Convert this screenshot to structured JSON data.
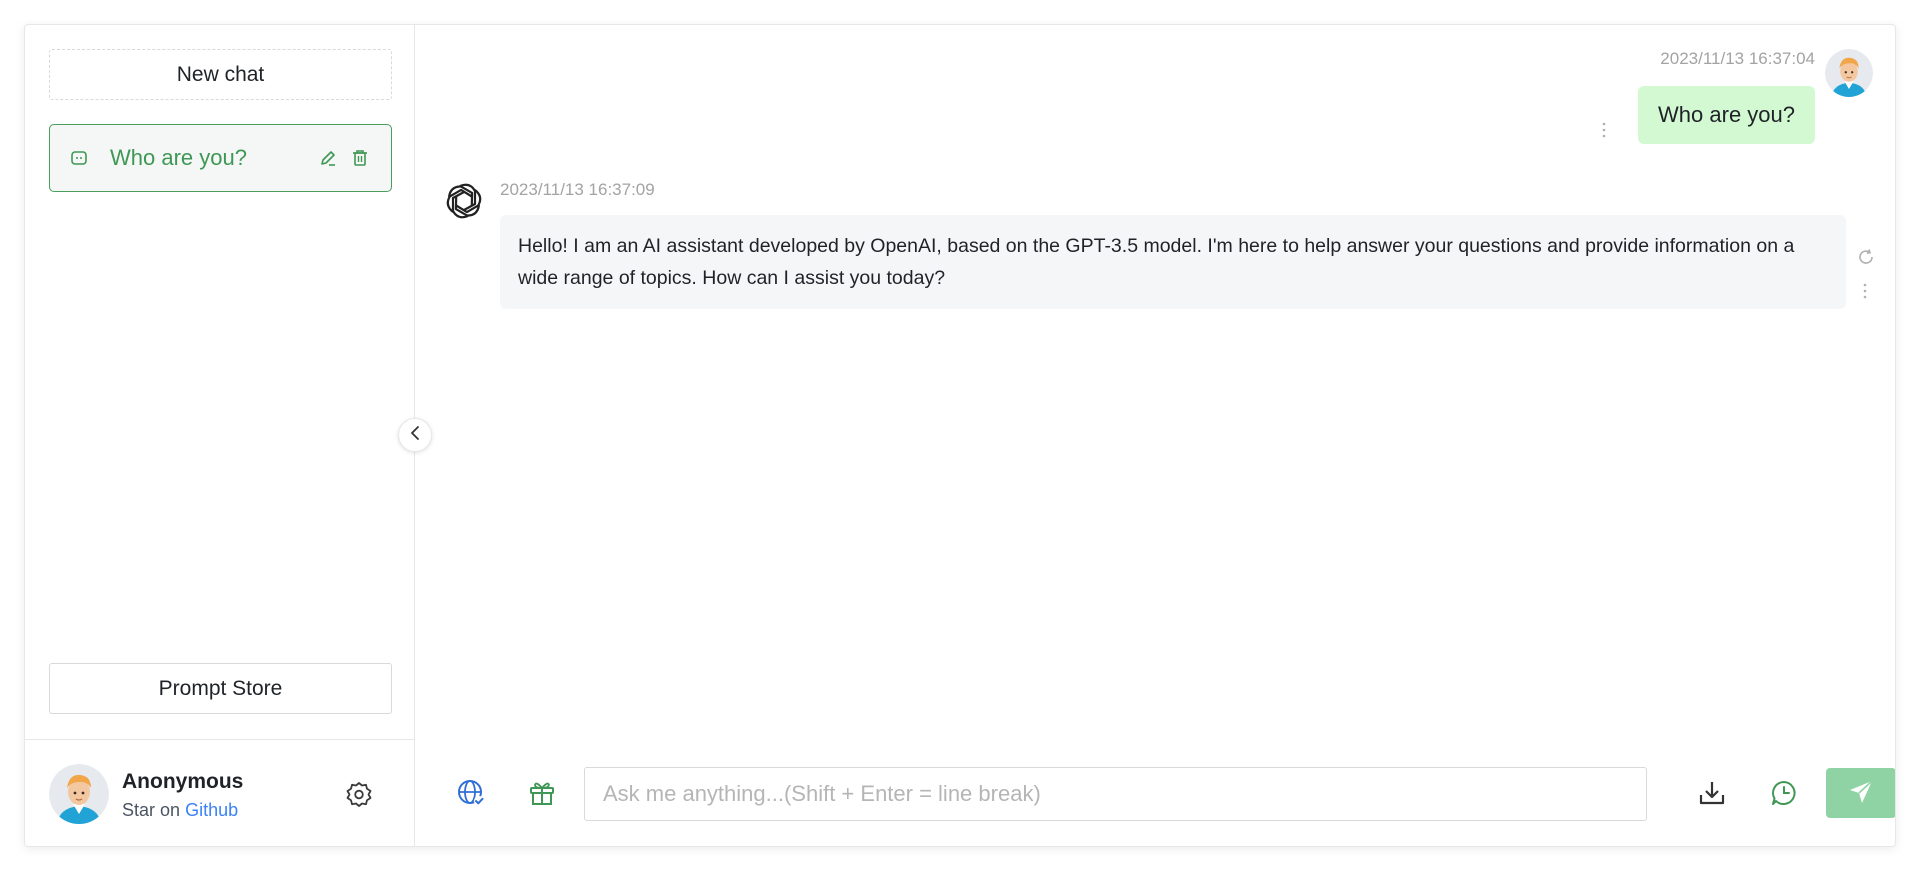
{
  "sidebar": {
    "new_chat_label": "New chat",
    "conversations": [
      {
        "title": "Who are you?",
        "active": true
      }
    ],
    "prompt_store_label": "Prompt Store",
    "user": {
      "name": "Anonymous",
      "star_prefix": "Star on",
      "star_link": "Github"
    }
  },
  "chat": {
    "messages": [
      {
        "role": "user",
        "time": "2023/11/13 16:37:04",
        "text": "Who are you?"
      },
      {
        "role": "assistant",
        "time": "2023/11/13 16:37:09",
        "text": "Hello! I am an AI assistant developed by OpenAI, based on the GPT-3.5 model. I'm here to help answer your questions and provide information on a wide range of topics. How can I assist you today?"
      }
    ]
  },
  "input": {
    "placeholder": "Ask me anything...(Shift + Enter = line break)",
    "value": ""
  },
  "colors": {
    "accent_green": "#3f9755",
    "user_bubble": "#d2f9d1",
    "bot_bubble": "#f4f6f8",
    "send_button": "#8fd3a4",
    "link_blue": "#3b82f6"
  },
  "icons": {
    "conversation": "chat-bubble-icon",
    "edit": "pencil-icon",
    "delete": "trash-icon",
    "settings": "gear-icon",
    "collapse": "chevron-left-icon",
    "bot": "openai-logo-icon",
    "regenerate": "refresh-icon",
    "more": "more-vertical-icon",
    "web": "globe-check-icon",
    "prompt": "gift-icon",
    "export": "download-icon",
    "history": "clock-chat-icon",
    "send": "send-icon"
  }
}
